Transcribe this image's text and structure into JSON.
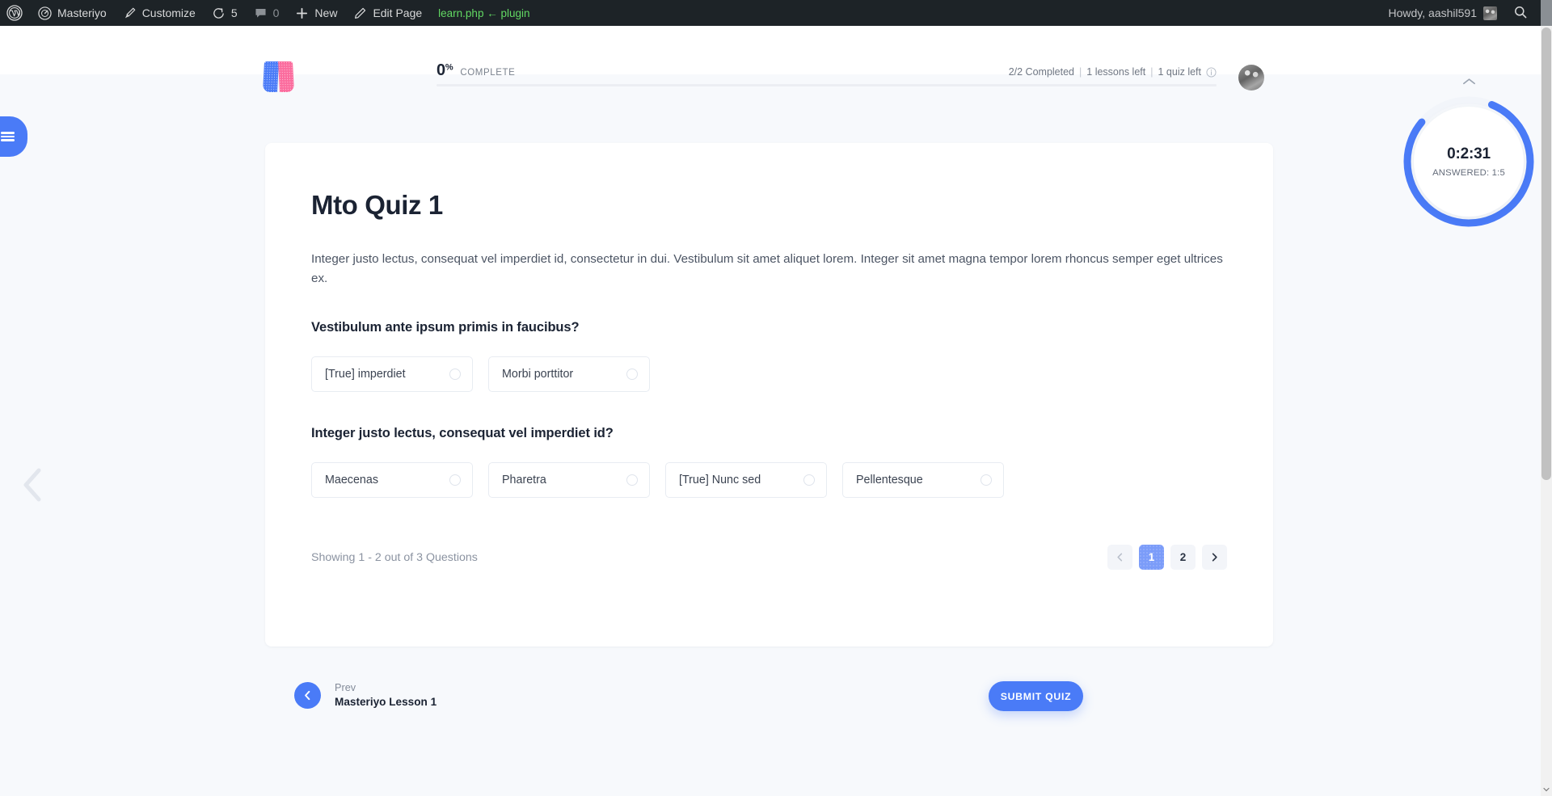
{
  "adminbar": {
    "logo_icon": "wordpress-logo-icon",
    "items": [
      {
        "label": "Masteriyo",
        "icon": "dashboard-icon"
      },
      {
        "label": "Customize",
        "icon": "paintbrush-icon"
      },
      {
        "label": "5",
        "icon": "updates-icon"
      },
      {
        "label": "0",
        "icon": "comment-bubble-icon"
      },
      {
        "label": "New",
        "icon": "plus-icon"
      },
      {
        "label": "Edit Page",
        "icon": "pencil-icon"
      }
    ],
    "plugin_note": "learn.php ← plugin",
    "howdy": "Howdy, aashil591",
    "search_icon": "search-icon",
    "avatar_icon": "avatar"
  },
  "header": {
    "logo_icon": "masteriyo-book-logo",
    "progress_percent": "0",
    "progress_percent_sign": "%",
    "progress_label": "COMPLETE",
    "progress_value": 0,
    "stats": {
      "completed": "2/2 Completed",
      "sep1": "|",
      "lessons_left": "1 lessons left",
      "sep2": "|",
      "quiz_left": "1 quiz left",
      "info_icon": "info-circle-icon"
    },
    "avatar_icon": "user-avatar"
  },
  "sidebar": {
    "toggle_icon": "hamburger-menu-icon"
  },
  "nav": {
    "prev_arrow_icon": "chevron-left-icon"
  },
  "quiz": {
    "title": "Mto Quiz 1",
    "description": "Integer justo lectus, consequat vel imperdiet id, consectetur in dui. Vestibulum sit amet aliquet lorem. Integer sit amet magna tempor lorem rhoncus semper eget ultrices ex.",
    "questions": [
      {
        "text": "Vestibulum ante ipsum primis in faucibus?",
        "options": [
          {
            "label": "[True] imperdiet",
            "selected": false
          },
          {
            "label": "Morbi porttitor",
            "selected": false
          }
        ]
      },
      {
        "text": "Integer justo lectus, consequat vel imperdiet id?",
        "options": [
          {
            "label": "Maecenas",
            "selected": false
          },
          {
            "label": "Pharetra",
            "selected": false
          },
          {
            "label": "[True] Nunc sed",
            "selected": false
          },
          {
            "label": "Pellentesque",
            "selected": false
          }
        ]
      }
    ],
    "showing_text": "Showing 1 - 2 out of 3 Questions",
    "pagination": {
      "prev_icon": "chevron-left-icon",
      "pages": [
        "1",
        "2"
      ],
      "active_page": "1",
      "next_icon": "chevron-right-icon"
    }
  },
  "footer": {
    "prev_icon": "chevron-left-icon",
    "prev_kicker": "Prev",
    "prev_title": "Masteriyo Lesson 1",
    "submit_label": "SUBMIT QUIZ"
  },
  "timer": {
    "collapse_icon": "chevron-up-icon",
    "time": "0:2:31",
    "answered": "ANSWERED: 1:5",
    "ring_progress": 0.8
  },
  "colors": {
    "accent": "#4a7bf7",
    "accent_light": "#7b9cf9",
    "pink": "#fb6b9d",
    "admin_bar": "#1d2327",
    "plugin_green": "#62d963",
    "page_bg": "#f7f9fc",
    "card_bg": "#ffffff",
    "text_dark": "#1b2333",
    "text_muted": "#8b93a1"
  }
}
